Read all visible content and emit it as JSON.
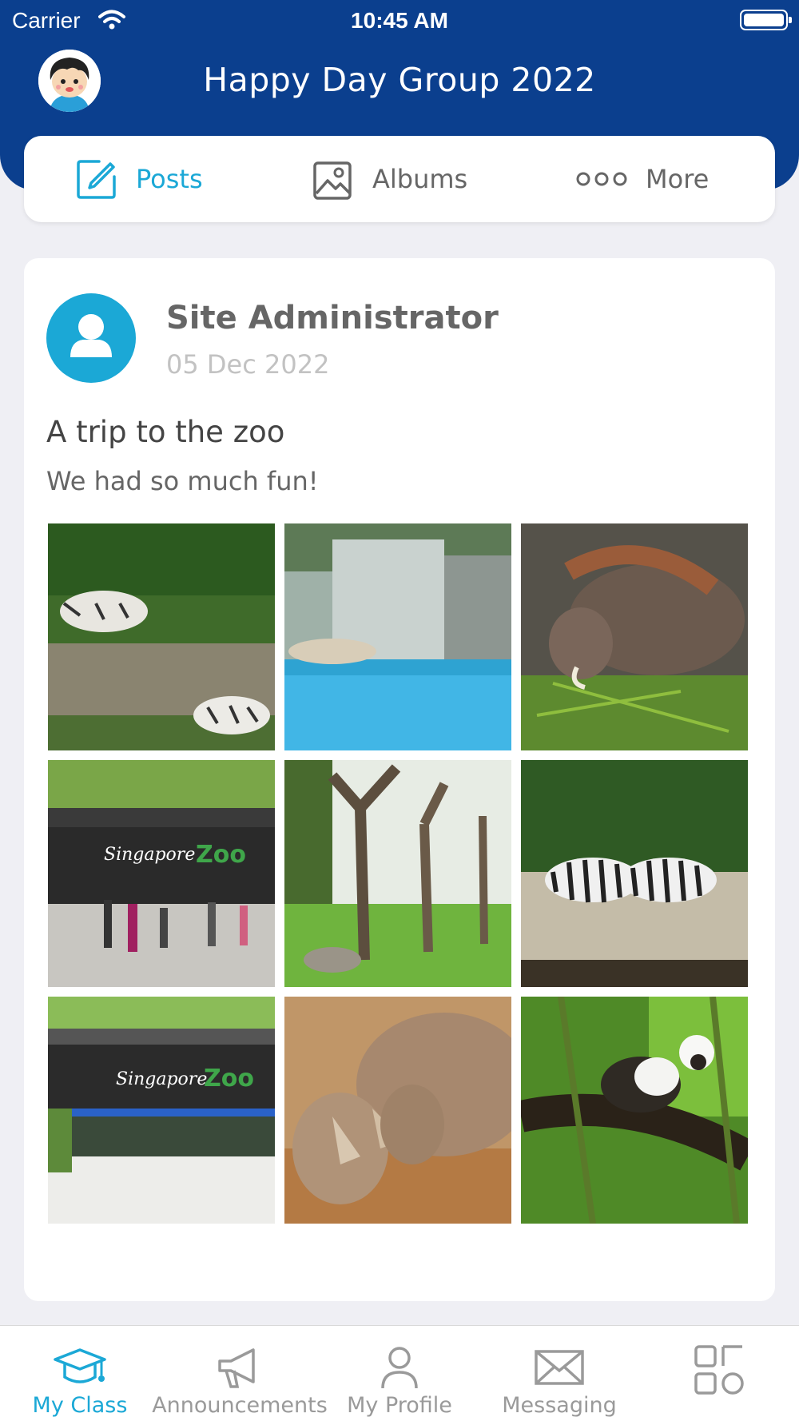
{
  "status_bar": {
    "carrier": "Carrier",
    "time": "10:45 AM"
  },
  "header": {
    "title": "Happy Day Group 2022"
  },
  "tabs": [
    {
      "label": "Posts",
      "icon": "edit-icon",
      "active": true
    },
    {
      "label": "Albums",
      "icon": "image-icon",
      "active": false
    },
    {
      "label": "More",
      "icon": "more-dots-icon",
      "active": false
    }
  ],
  "post": {
    "author": "Site Administrator",
    "date": "05 Dec 2022",
    "title": "A trip to the zoo",
    "body": "We had so much fun!",
    "photos": [
      "white tigers",
      "polar bear pool",
      "warthog",
      "Singapore Zoo entrance crowd",
      "tree enclosure",
      "zebras",
      "Singapore Zoo entrance",
      "rhinos",
      "monkey on branch"
    ]
  },
  "bottom_nav": [
    {
      "label": "My Class",
      "icon": "graduation-cap-icon",
      "active": true
    },
    {
      "label": "Announcements",
      "icon": "megaphone-icon",
      "active": false
    },
    {
      "label": "My Profile",
      "icon": "person-icon",
      "active": false
    },
    {
      "label": "Messaging",
      "icon": "envelope-icon",
      "active": false
    },
    {
      "label": "",
      "icon": "grid-menu-icon",
      "active": false
    }
  ],
  "colors": {
    "header_bg": "#0b3f8e",
    "accent": "#1ba8d6",
    "inactive": "#9a9a9a",
    "page_bg": "#efeff4"
  }
}
